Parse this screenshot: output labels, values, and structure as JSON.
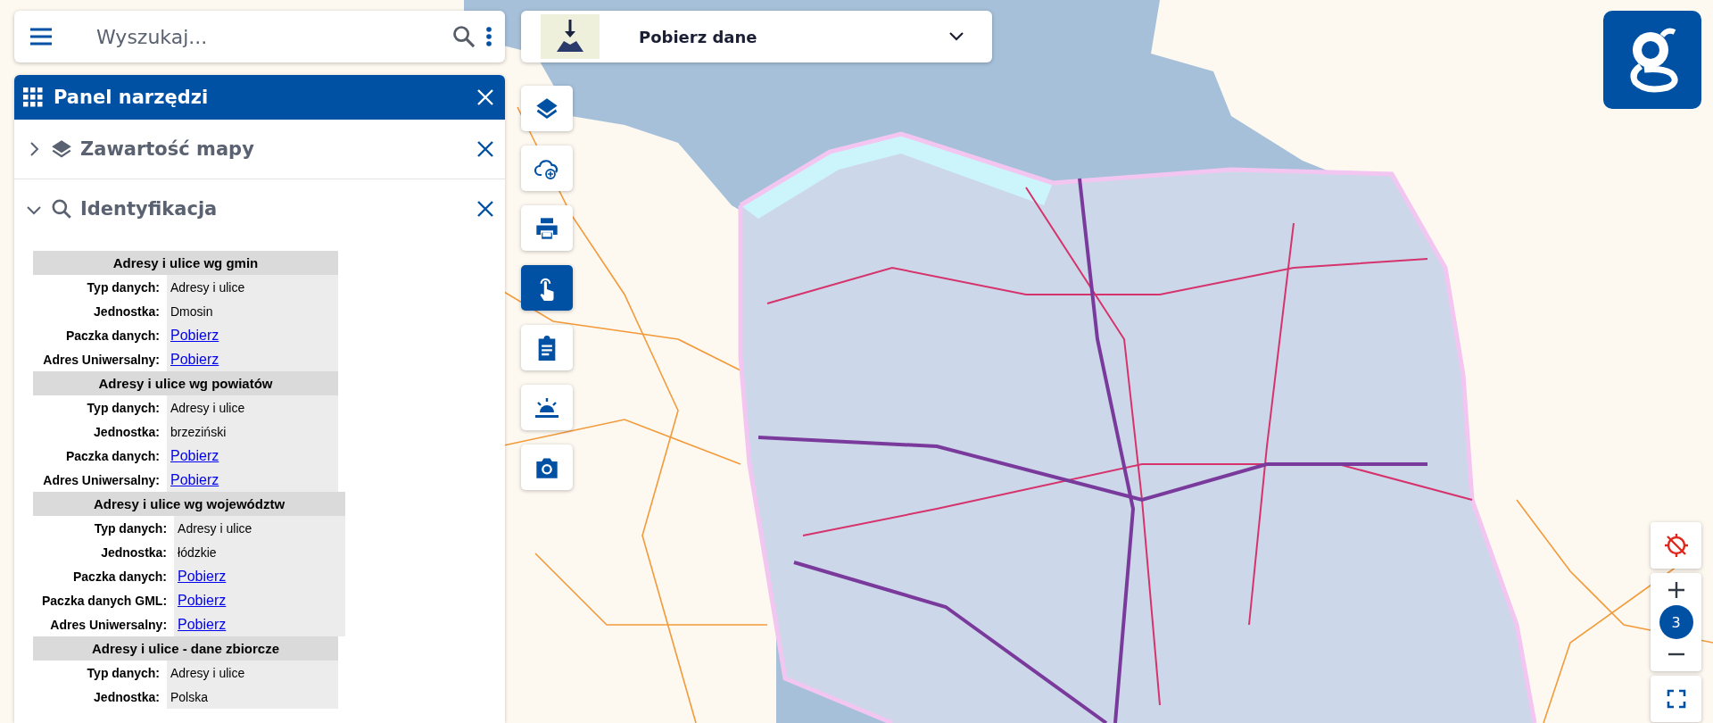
{
  "search": {
    "placeholder": "Wyszukaj..."
  },
  "tool_panel": {
    "title": "Panel narzędzi",
    "sections": [
      {
        "kind": "layers",
        "title": "Zawartość mapy",
        "expanded": false
      },
      {
        "kind": "identify",
        "title": "Identyfikacja",
        "expanded": true,
        "results": [
          {
            "title": "Adresy i ulice wg gmin",
            "rows": [
              {
                "kind": "text",
                "label": "Typ danych:",
                "value": "Adresy i ulice"
              },
              {
                "kind": "text",
                "label": "Jednostka:",
                "value": "Dmosin"
              },
              {
                "kind": "link",
                "label": "Paczka danych:",
                "value": "Pobierz"
              },
              {
                "kind": "link",
                "label": "Adres Uniwersalny:",
                "value": "Pobierz"
              }
            ]
          },
          {
            "title": "Adresy i ulice wg powiatów",
            "rows": [
              {
                "kind": "text",
                "label": "Typ danych:",
                "value": "Adresy i ulice"
              },
              {
                "kind": "text",
                "label": "Jednostka:",
                "value": "brzeziński"
              },
              {
                "kind": "link",
                "label": "Paczka danych:",
                "value": "Pobierz"
              },
              {
                "kind": "link",
                "label": "Adres Uniwersalny:",
                "value": "Pobierz"
              }
            ]
          },
          {
            "title": "Adresy i ulice wg województw",
            "rows": [
              {
                "kind": "text",
                "label": "Typ danych:",
                "value": "Adresy i ulice"
              },
              {
                "kind": "text",
                "label": "Jednostka:",
                "value": "łódzkie"
              },
              {
                "kind": "link",
                "label": "Paczka danych:",
                "value": "Pobierz"
              },
              {
                "kind": "link",
                "label": "Paczka danych GML:",
                "value": "Pobierz"
              },
              {
                "kind": "link",
                "label": "Adres Uniwersalny:",
                "value": "Pobierz"
              }
            ]
          },
          {
            "title": "Adresy i ulice - dane zbiorcze",
            "rows": [
              {
                "kind": "text",
                "label": "Typ danych:",
                "value": "Adresy i ulice"
              },
              {
                "kind": "text",
                "label": "Jednostka:",
                "value": "Polska"
              }
            ]
          }
        ]
      }
    ]
  },
  "download_dropdown": {
    "label": "Pobierz dane"
  },
  "toolbar": [
    {
      "kind": "layers",
      "selected": false
    },
    {
      "kind": "cloud-add",
      "selected": false
    },
    {
      "kind": "print",
      "selected": false
    },
    {
      "kind": "identify",
      "selected": true
    },
    {
      "kind": "clipboard",
      "selected": false
    },
    {
      "kind": "horizon",
      "selected": false
    },
    {
      "kind": "camera",
      "selected": false
    }
  ],
  "zoom": {
    "level_label": "3"
  }
}
